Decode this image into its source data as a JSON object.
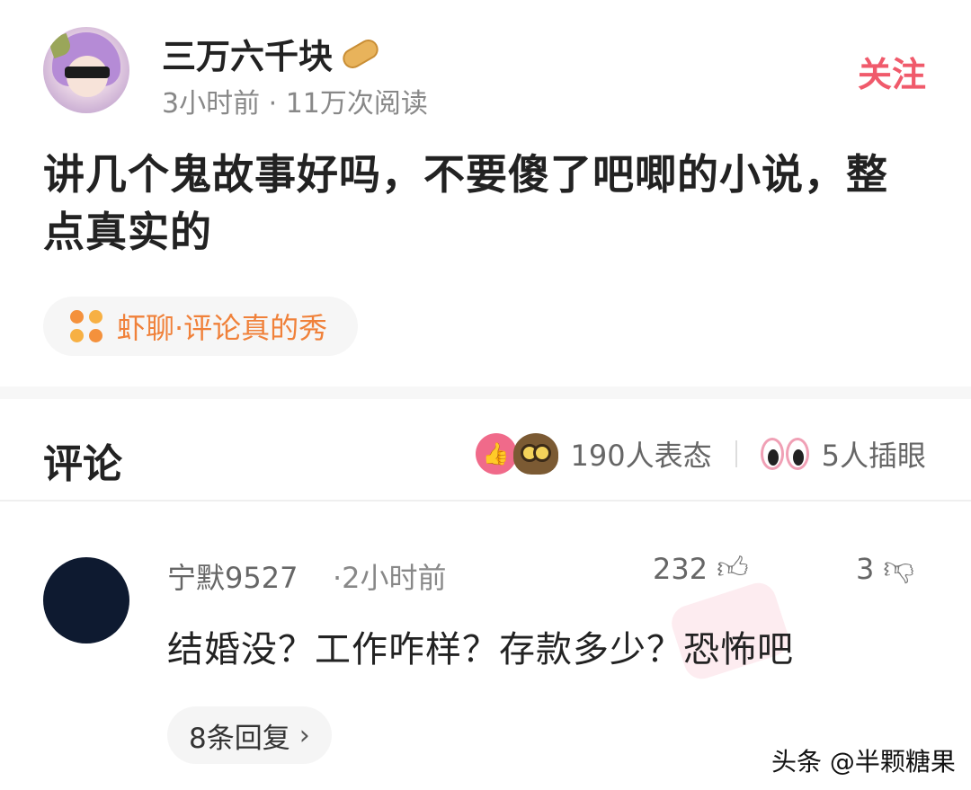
{
  "post": {
    "author": "三万六千块",
    "meta": "3小时前 · 11万次阅读",
    "follow_label": "关注",
    "title": "讲几个鬼故事好吗，不要傻了吧唧的小说，整点真实的",
    "topic": "虾聊·评论真的秀"
  },
  "comments_section": {
    "title": "评论",
    "reactions_count": "190人表态",
    "peek_count": "5人插眼"
  },
  "comment": {
    "user": "宁默9527",
    "time": "·2小时前",
    "likes": "232",
    "dislikes": "3",
    "text": "结婚没？工作咋样？存款多少？恐怖吧",
    "replies_label": "8条回复"
  },
  "watermark": "头条 @半颗糖果",
  "icons": [
    "avatar",
    "peanut-icon",
    "topic-icon",
    "like-reaction-icon",
    "owl-reaction-icon",
    "eyes-reaction-icon",
    "thumb-up-icon",
    "thumb-down-icon",
    "chevron-right-icon"
  ],
  "colors": {
    "accent": "#f05a6b",
    "topic": "#f0813a",
    "muted": "#888888"
  }
}
